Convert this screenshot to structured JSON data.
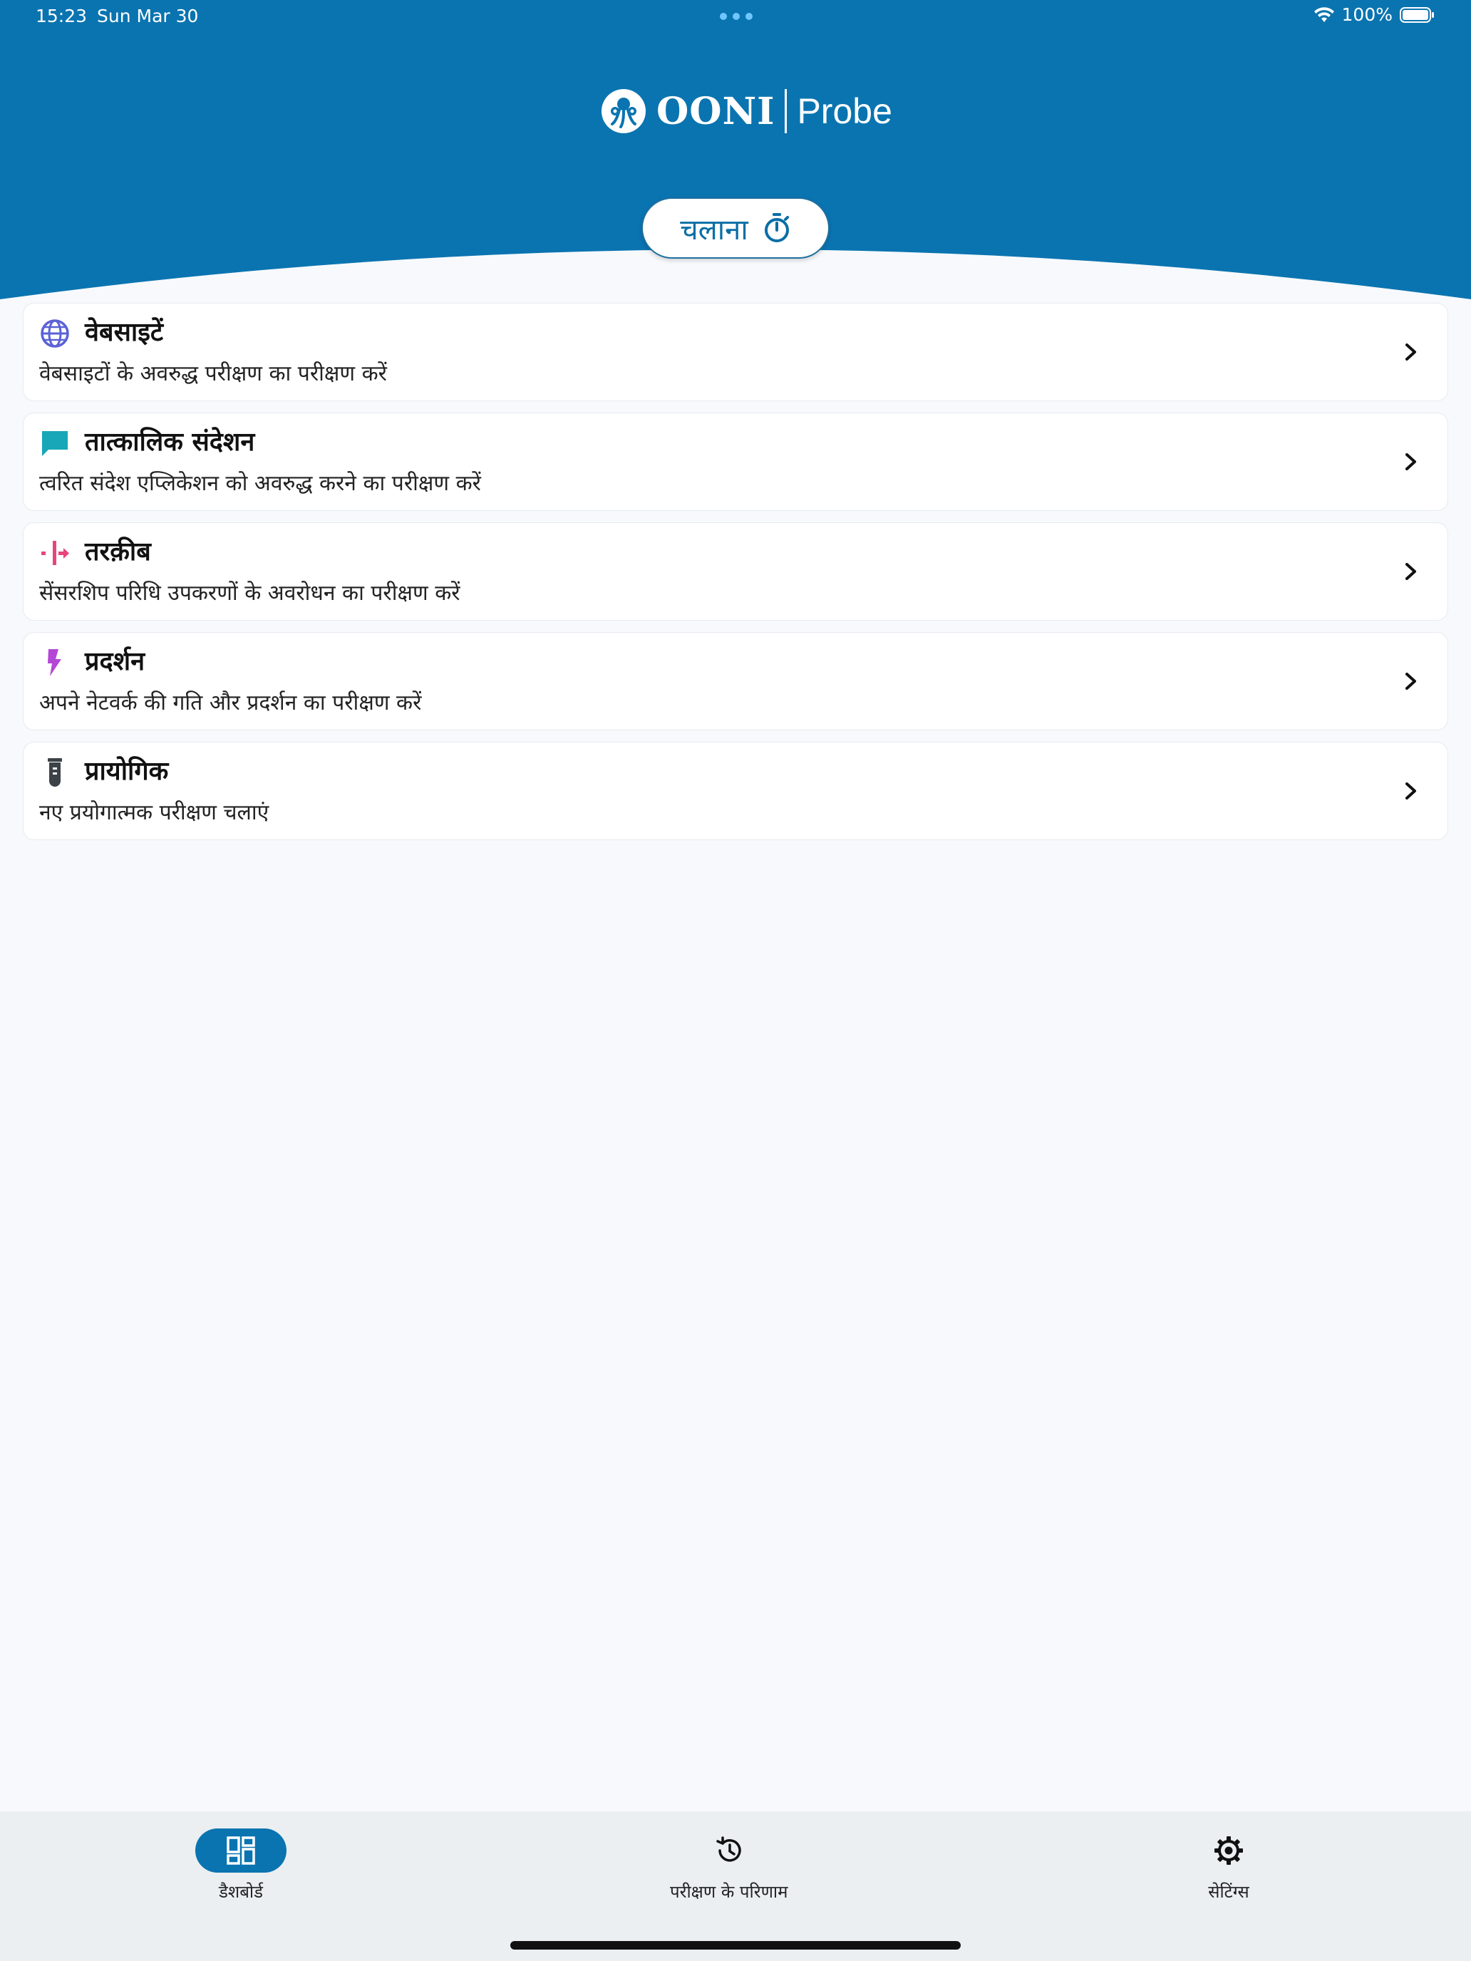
{
  "status_bar": {
    "time": "15:23",
    "date": "Sun Mar 30",
    "battery": "100%",
    "wifi_icon": "wifi-icon",
    "battery_icon": "battery-full-icon"
  },
  "header": {
    "logo_ooni": "OONI",
    "logo_probe": "Probe",
    "logo_icon": "ooni-octopus-icon",
    "run_label": "चलाना",
    "run_icon": "stopwatch-icon"
  },
  "cards": [
    {
      "title": "वेबसाइटें",
      "description": "वेबसाइटों के अवरुद्ध परीक्षण का परीक्षण करें",
      "icon": "globe-icon",
      "color": "#5a62d6"
    },
    {
      "title": "तात्कालिक संदेशन",
      "description": "त्वरित संदेश एप्लिकेशन को अवरुद्ध करने का परीक्षण करें",
      "icon": "chat-bubble-icon",
      "color": "#17a7b8"
    },
    {
      "title": "तरक़ीब",
      "description": "सेंसरशिप परिधि उपकरणों के अवरोधन का परीक्षण करें",
      "icon": "middlebox-icon",
      "color": "#e8457a"
    },
    {
      "title": "प्रदर्शन",
      "description": "अपने नेटवर्क की गति और प्रदर्शन का परीक्षण करें",
      "icon": "lightning-icon",
      "color": "#b447d6"
    },
    {
      "title": "प्रायोगिक",
      "description": "नए प्रयोगात्मक परीक्षण चलाएं",
      "icon": "test-tube-icon",
      "color": "#3c4247"
    }
  ],
  "bottom_nav": {
    "items": [
      {
        "label": "डैशबोर्ड",
        "icon": "dashboard-icon",
        "active": true
      },
      {
        "label": "परीक्षण के परिणाम",
        "icon": "history-icon",
        "active": false
      },
      {
        "label": "सेटिंग्स",
        "icon": "gear-icon",
        "active": false
      }
    ]
  },
  "colors": {
    "header_blue": "#0a74b0",
    "background": "#f7f9fc",
    "nav_background": "#ebeff2"
  }
}
